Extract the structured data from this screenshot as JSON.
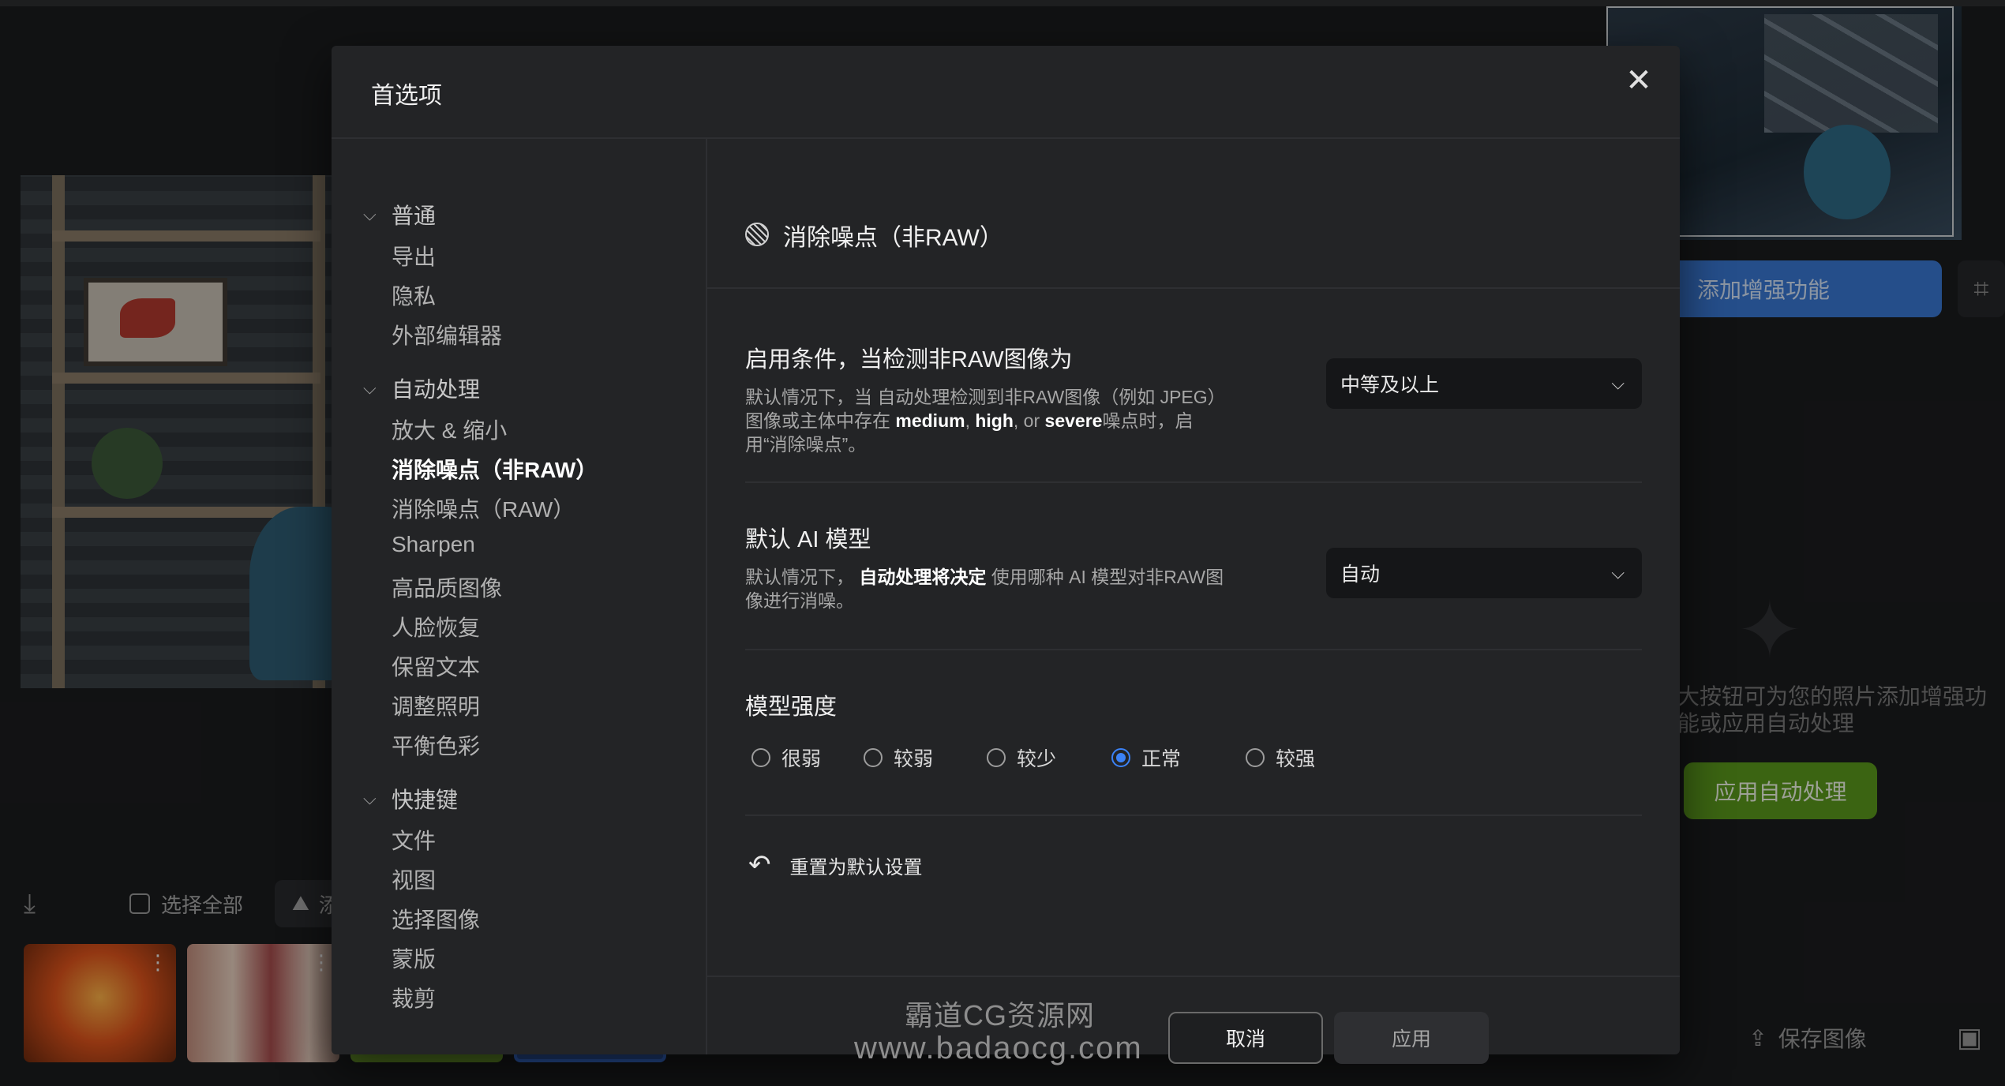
{
  "modal": {
    "title": "首选项",
    "close": "✕"
  },
  "sidebar": {
    "groups": [
      {
        "label": "普通",
        "items": [
          "导出",
          "隐私",
          "外部编辑器"
        ]
      },
      {
        "label": "自动处理",
        "items": [
          "放大 & 缩小",
          "消除噪点（非RAW）",
          "消除噪点（RAW）",
          "Sharpen",
          "高品质图像",
          "人脸恢复",
          "保留文本",
          "调整照明",
          "平衡色彩"
        ]
      },
      {
        "label": "快捷键",
        "items": [
          "文件",
          "视图",
          "选择图像",
          "蒙版",
          "裁剪"
        ]
      }
    ],
    "active_item": "消除噪点（非RAW）"
  },
  "section": {
    "title": "消除噪点（非RAW）",
    "condition": {
      "label": "启用条件，当检测非RAW图像为",
      "desc_pre": "默认情况下，当 自动处理检测到非RAW图像（例如 JPEG）图像或主体中存在 ",
      "kw1": "medium",
      "sep1": ", ",
      "kw2": "high",
      "sep2": ", or ",
      "kw3": "severe",
      "desc_post": "噪点时，启用“消除噪点”。",
      "value": "中等及以上"
    },
    "model": {
      "label": "默认 AI 模型",
      "desc_pre": "默认情况下， ",
      "desc_bold": "自动处理将决定",
      "desc_post": " 使用哪种 AI 模型对非RAW图像进行消噪。",
      "value": "自动"
    },
    "strength": {
      "label": "模型强度",
      "options": [
        "很弱",
        "较弱",
        "较少",
        "正常",
        "较强"
      ],
      "selected": "正常"
    },
    "reset": "重置为默认设置"
  },
  "footer": {
    "cancel": "取消",
    "apply": "应用"
  },
  "background": {
    "enhance": "添加增强功能",
    "hint": "大按钮可为您的照片添加增强功能或应用自动处理",
    "auto": "应用自动处理",
    "save": "保存图像",
    "select_all": "选择全部",
    "add": "添加"
  },
  "watermark": {
    "line1": "霸道CG资源网",
    "line2": "www.badaocg.com"
  },
  "colors": {
    "accent": "#3b82f6",
    "primary_green": "#5b9a1d",
    "enhance_blue": "#3a78d4"
  }
}
